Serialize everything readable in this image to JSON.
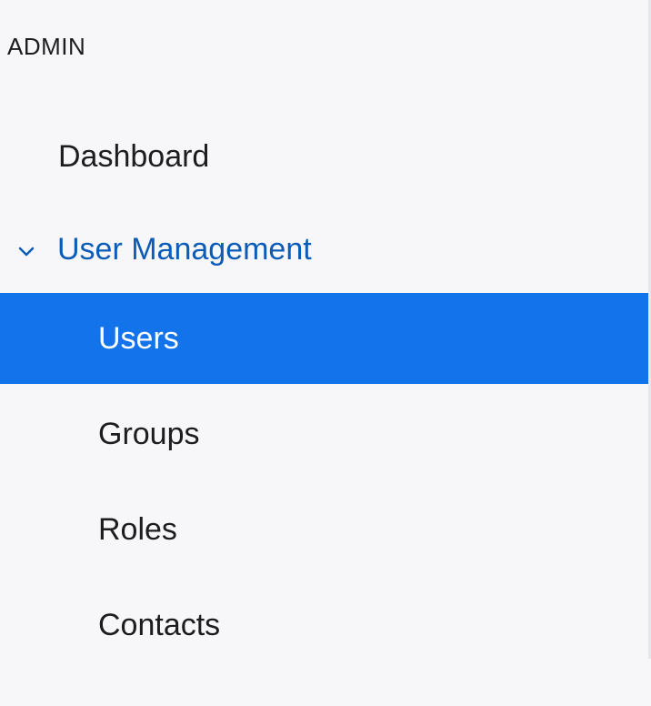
{
  "sidebar": {
    "section_title": "ADMIN",
    "items": [
      {
        "label": "Dashboard"
      },
      {
        "label": "User Management",
        "expanded": true,
        "icon": "chevron-down-icon"
      },
      {
        "label": "Users",
        "selected": true
      },
      {
        "label": "Groups"
      },
      {
        "label": "Roles"
      },
      {
        "label": "Contacts"
      }
    ],
    "colors": {
      "background": "#f7f7f9",
      "selected_background": "#1373ea",
      "selected_text": "#ffffff",
      "group_text": "#0b5cb8",
      "text": "#1d1d1f"
    }
  }
}
